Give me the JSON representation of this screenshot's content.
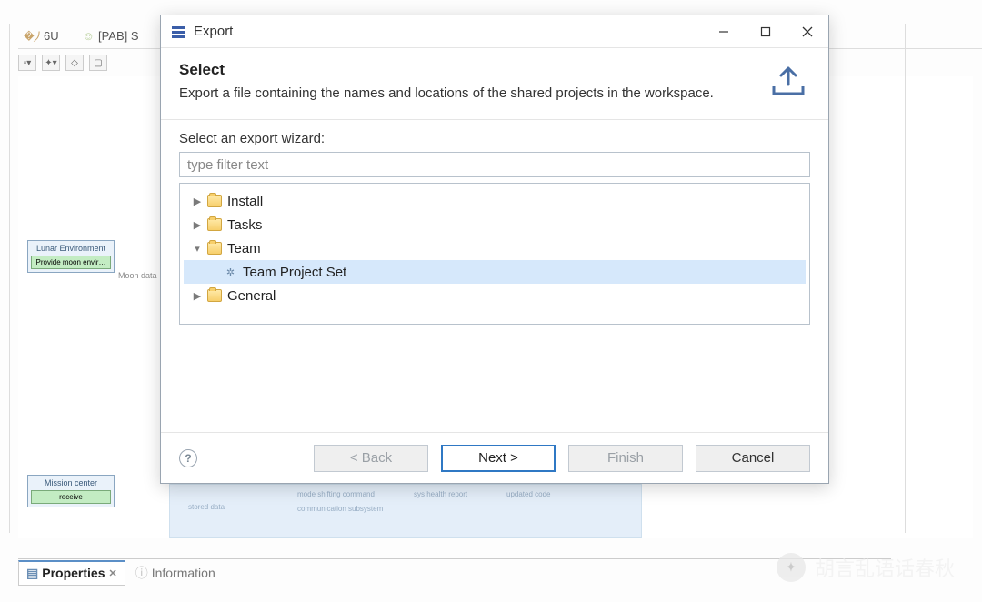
{
  "ide": {
    "tabs": [
      "6U",
      "[PAB] S"
    ],
    "block1": {
      "title": "Lunar Environment",
      "inner": "Provide moon envir…",
      "edge": "Moon data"
    },
    "block2": {
      "title": "Mission center",
      "inner": "receive"
    },
    "bottom_tabs": {
      "properties": "Properties",
      "information": "Information"
    },
    "faded": {
      "a": "stored data",
      "b": "mode shifting command",
      "c": "communication subsystem",
      "d": "sys health report",
      "e": "updated code"
    }
  },
  "dialog": {
    "title": "Export",
    "heading": "Select",
    "description": "Export a file containing the names and locations of the shared projects in the workspace.",
    "select_label": "Select an export wizard:",
    "filter_placeholder": "type filter text",
    "tree": {
      "install": "Install",
      "tasks": "Tasks",
      "team": "Team",
      "team_project_set": "Team Project Set",
      "general": "General"
    },
    "buttons": {
      "back": "< Back",
      "next": "Next >",
      "finish": "Finish",
      "cancel": "Cancel"
    }
  },
  "watermark": "胡言乱语话春秋"
}
